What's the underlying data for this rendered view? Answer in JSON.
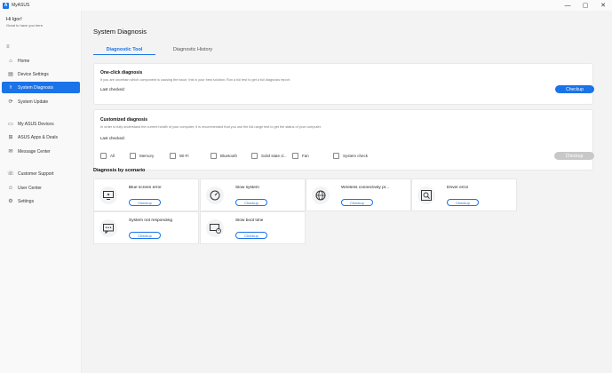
{
  "window": {
    "title": "MyASUS",
    "logo_text": "A",
    "minimize": "—",
    "maximize": "▢",
    "close": "✕"
  },
  "user": {
    "greeting": "Hi Igor!",
    "subtitle": "Great to have you here."
  },
  "sidebar": {
    "menu_icon": "≡",
    "items": [
      {
        "label": "Home",
        "icon": "home-icon",
        "glyph": "⌂"
      },
      {
        "label": "Device Settings",
        "icon": "settings-grid-icon",
        "glyph": "▤"
      },
      {
        "label": "System Diagnosis",
        "icon": "diagnosis-icon",
        "glyph": "⚕"
      },
      {
        "label": "System Update",
        "icon": "update-icon",
        "glyph": "⟳"
      },
      {
        "label": "My ASUS Devices",
        "icon": "devices-icon",
        "glyph": "▭"
      },
      {
        "label": "ASUS Apps & Deals",
        "icon": "apps-icon",
        "glyph": "⊞"
      },
      {
        "label": "Message Center",
        "icon": "message-icon",
        "glyph": "✉"
      },
      {
        "label": "Customer Support",
        "icon": "support-icon",
        "glyph": "☏"
      },
      {
        "label": "User Center",
        "icon": "user-icon",
        "glyph": "☺"
      },
      {
        "label": "Settings",
        "icon": "gear-icon",
        "glyph": "⚙"
      }
    ]
  },
  "main": {
    "title": "System Diagnosis",
    "tabs": [
      {
        "label": "Diagnostic Tool"
      },
      {
        "label": "Diagnostic History"
      }
    ],
    "one_click": {
      "title": "One-click diagnosis",
      "desc": "If you are uncertain which component is causing the issue, this is your best solution. Run a full test to get a full diagnosis report.",
      "last_checked": "Last checked:",
      "button": "Checkup"
    },
    "customized": {
      "title": "Customized diagnosis",
      "desc": "In order to fully understand the current health of your computer, it is recommended that you use the full-range test to get the status of your computer.",
      "last_checked": "Last checked:",
      "button": "Checkup",
      "options": [
        "All",
        "Memory",
        "Wi-Fi",
        "Bluetooth",
        "Solid state d...",
        "Fan",
        "System check"
      ]
    },
    "scenario": {
      "title": "Diagnosis by scenario",
      "button": "Checkup",
      "items": [
        {
          "label": "Blue screen error",
          "icon": "monitor-error-icon"
        },
        {
          "label": "Slow system",
          "icon": "speedometer-icon"
        },
        {
          "label": "Wireless connectivity pr...",
          "icon": "globe-icon"
        },
        {
          "label": "Driver error",
          "icon": "driver-search-icon"
        },
        {
          "label": "System not responding",
          "icon": "chat-dots-icon"
        },
        {
          "label": "Slow boot time",
          "icon": "screen-clock-icon"
        }
      ]
    }
  },
  "colors": {
    "accent": "#1a73e8",
    "disabled": "#c8c8c8",
    "background": "#f3f3f3"
  }
}
